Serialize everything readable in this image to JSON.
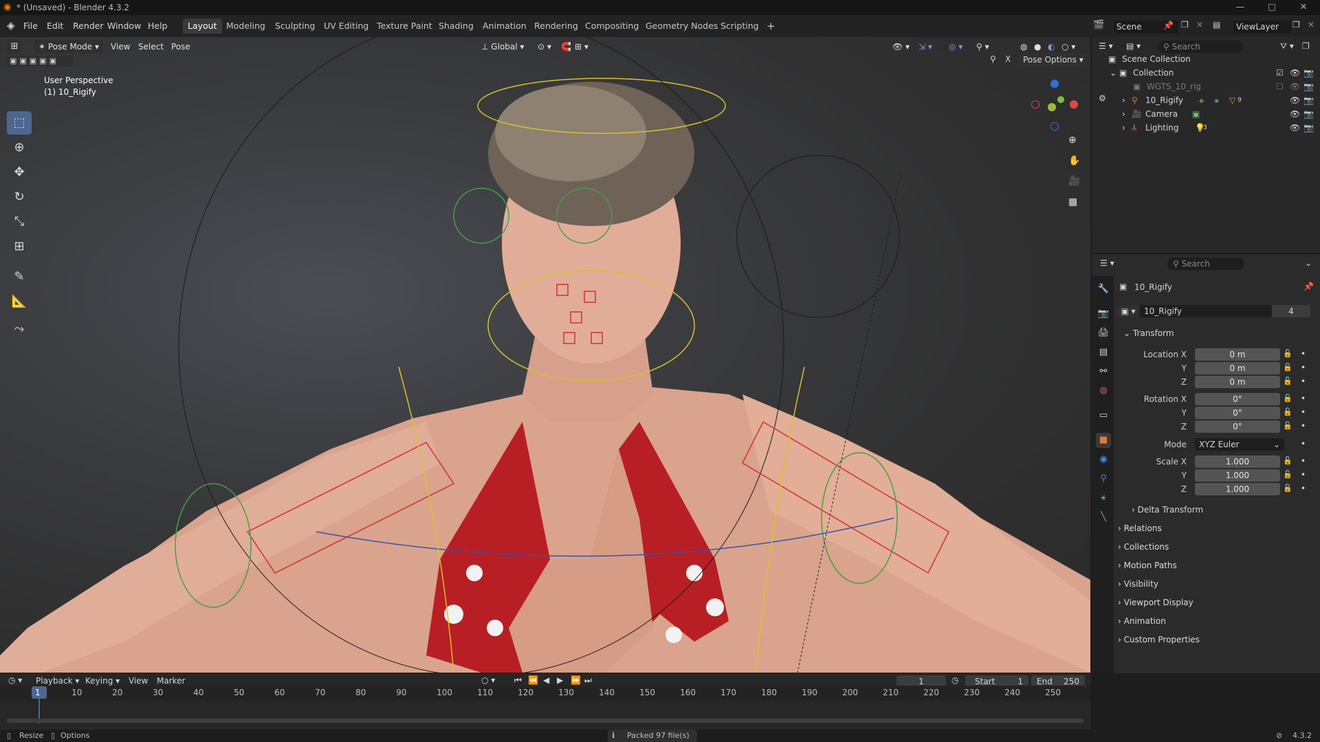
{
  "window": {
    "title": "* (Unsaved) - Blender 4.3.2"
  },
  "menu": [
    "File",
    "Edit",
    "Render",
    "Window",
    "Help"
  ],
  "workspaces": [
    "Layout",
    "Modeling",
    "Sculpting",
    "UV Editing",
    "Texture Paint",
    "Shading",
    "Animation",
    "Rendering",
    "Compositing",
    "Geometry Nodes",
    "Scripting"
  ],
  "active_workspace": "Layout",
  "scene": {
    "label": "Scene",
    "viewlayer": "ViewLayer"
  },
  "viewport": {
    "mode": "Pose Mode",
    "menus": [
      "View",
      "Select",
      "Pose"
    ],
    "orientation": "Global",
    "overlay_line1": "User Perspective",
    "overlay_line2": "(1) 10_Rigify",
    "pose_options": "Pose Options",
    "mirror_x": "X"
  },
  "outliner": {
    "search_placeholder": "Search",
    "scene_collection": "Scene Collection",
    "collection": "Collection",
    "items": [
      {
        "name": "WGTS_10_rig",
        "dimmed": true
      },
      {
        "name": "10_Rigify",
        "dimmed": false
      },
      {
        "name": "Camera",
        "dimmed": false
      },
      {
        "name": "Lighting",
        "dimmed": false
      }
    ],
    "badge_rigify": "9",
    "badge_lighting": "3"
  },
  "properties": {
    "search_placeholder": "Search",
    "object_name": "10_Rigify",
    "datablock_name": "10_Rigify",
    "user_count": "4",
    "transform_title": "Transform",
    "location": {
      "label": "Location X",
      "x": "0 m",
      "y": "0 m",
      "z": "0 m"
    },
    "rotation": {
      "label": "Rotation X",
      "x": "0°",
      "y": "0°",
      "z": "0°"
    },
    "mode_label": "Mode",
    "mode_value": "XYZ Euler",
    "scale": {
      "label": "Scale X",
      "x": "1.000",
      "y": "1.000",
      "z": "1.000"
    },
    "axis_y": "Y",
    "axis_z": "Z",
    "delta_transform": "Delta Transform",
    "sections": [
      "Relations",
      "Collections",
      "Motion Paths",
      "Visibility",
      "Viewport Display",
      "Animation",
      "Custom Properties"
    ]
  },
  "timeline": {
    "menus": [
      "Playback",
      "Keying",
      "View",
      "Marker"
    ],
    "current_frame": "1",
    "start_label": "Start",
    "start_value": "1",
    "end_label": "End",
    "end_value": "250",
    "ticks": [
      "1",
      "10",
      "20",
      "30",
      "40",
      "50",
      "60",
      "70",
      "80",
      "90",
      "100",
      "110",
      "120",
      "130",
      "140",
      "150",
      "160",
      "170",
      "180",
      "190",
      "200",
      "210",
      "220",
      "230",
      "240",
      "250"
    ]
  },
  "statusbar": {
    "left1": "Resize",
    "left2": "Options",
    "center": "Packed 97 file(s)",
    "version": "4.3.2"
  },
  "colors": {
    "accent": "#4d6790",
    "rig_green": "#43a047",
    "rig_red": "#d32f2f",
    "rig_yellow": "#d8c22a",
    "rig_blue": "#3552a8"
  }
}
